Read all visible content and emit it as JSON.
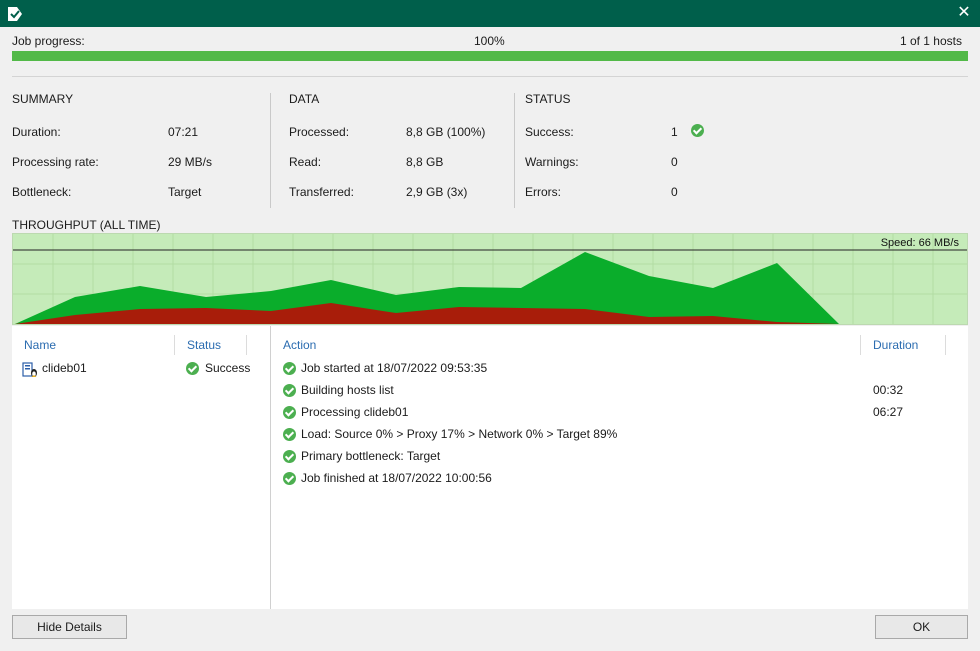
{
  "window": {
    "close_glyph": "✕",
    "icon": "job-icon"
  },
  "progress": {
    "label": "Job progress:",
    "percent_text": "100%",
    "hosts_text": "1 of 1 hosts",
    "fraction": 1.0,
    "color": "#52b948"
  },
  "summary": {
    "title": "SUMMARY",
    "rows": [
      {
        "label": "Duration:",
        "value": "07:21"
      },
      {
        "label": "Processing rate:",
        "value": "29 MB/s"
      },
      {
        "label": "Bottleneck:",
        "value": "Target"
      }
    ]
  },
  "data": {
    "title": "DATA",
    "rows": [
      {
        "label": "Processed:",
        "value": "8,8 GB (100%)"
      },
      {
        "label": "Read:",
        "value": "8,8 GB"
      },
      {
        "label": "Transferred:",
        "value": "2,9 GB (3x)"
      }
    ]
  },
  "status": {
    "title": "STATUS",
    "rows": [
      {
        "label": "Success:",
        "value": "1"
      },
      {
        "label": "Warnings:",
        "value": "0"
      },
      {
        "label": "Errors:",
        "value": "0"
      }
    ]
  },
  "throughput": {
    "title": "THROUGHPUT (ALL TIME)",
    "speed_label": "Speed: 66 MB/s",
    "colors": {
      "read": "#0aad2b",
      "transfer": "#a81d0a",
      "background": "#c5ebb9"
    }
  },
  "hosts_table": {
    "headers": {
      "name": "Name",
      "status": "Status"
    },
    "rows": [
      {
        "name": "clideb01",
        "status": "Success"
      }
    ]
  },
  "actions_table": {
    "headers": {
      "action": "Action",
      "duration": "Duration"
    },
    "rows": [
      {
        "action": "Job started at 18/07/2022 09:53:35",
        "duration": ""
      },
      {
        "action": "Building hosts list",
        "duration": "00:32"
      },
      {
        "action": "Processing clideb01",
        "duration": "06:27"
      },
      {
        "action": "Load: Source 0% > Proxy 17% > Network 0% > Target 89%",
        "duration": ""
      },
      {
        "action": "Primary bottleneck: Target",
        "duration": ""
      },
      {
        "action": "Job finished at 18/07/2022 10:00:56",
        "duration": ""
      }
    ]
  },
  "buttons": {
    "hide_details": "Hide Details",
    "ok": "OK"
  }
}
